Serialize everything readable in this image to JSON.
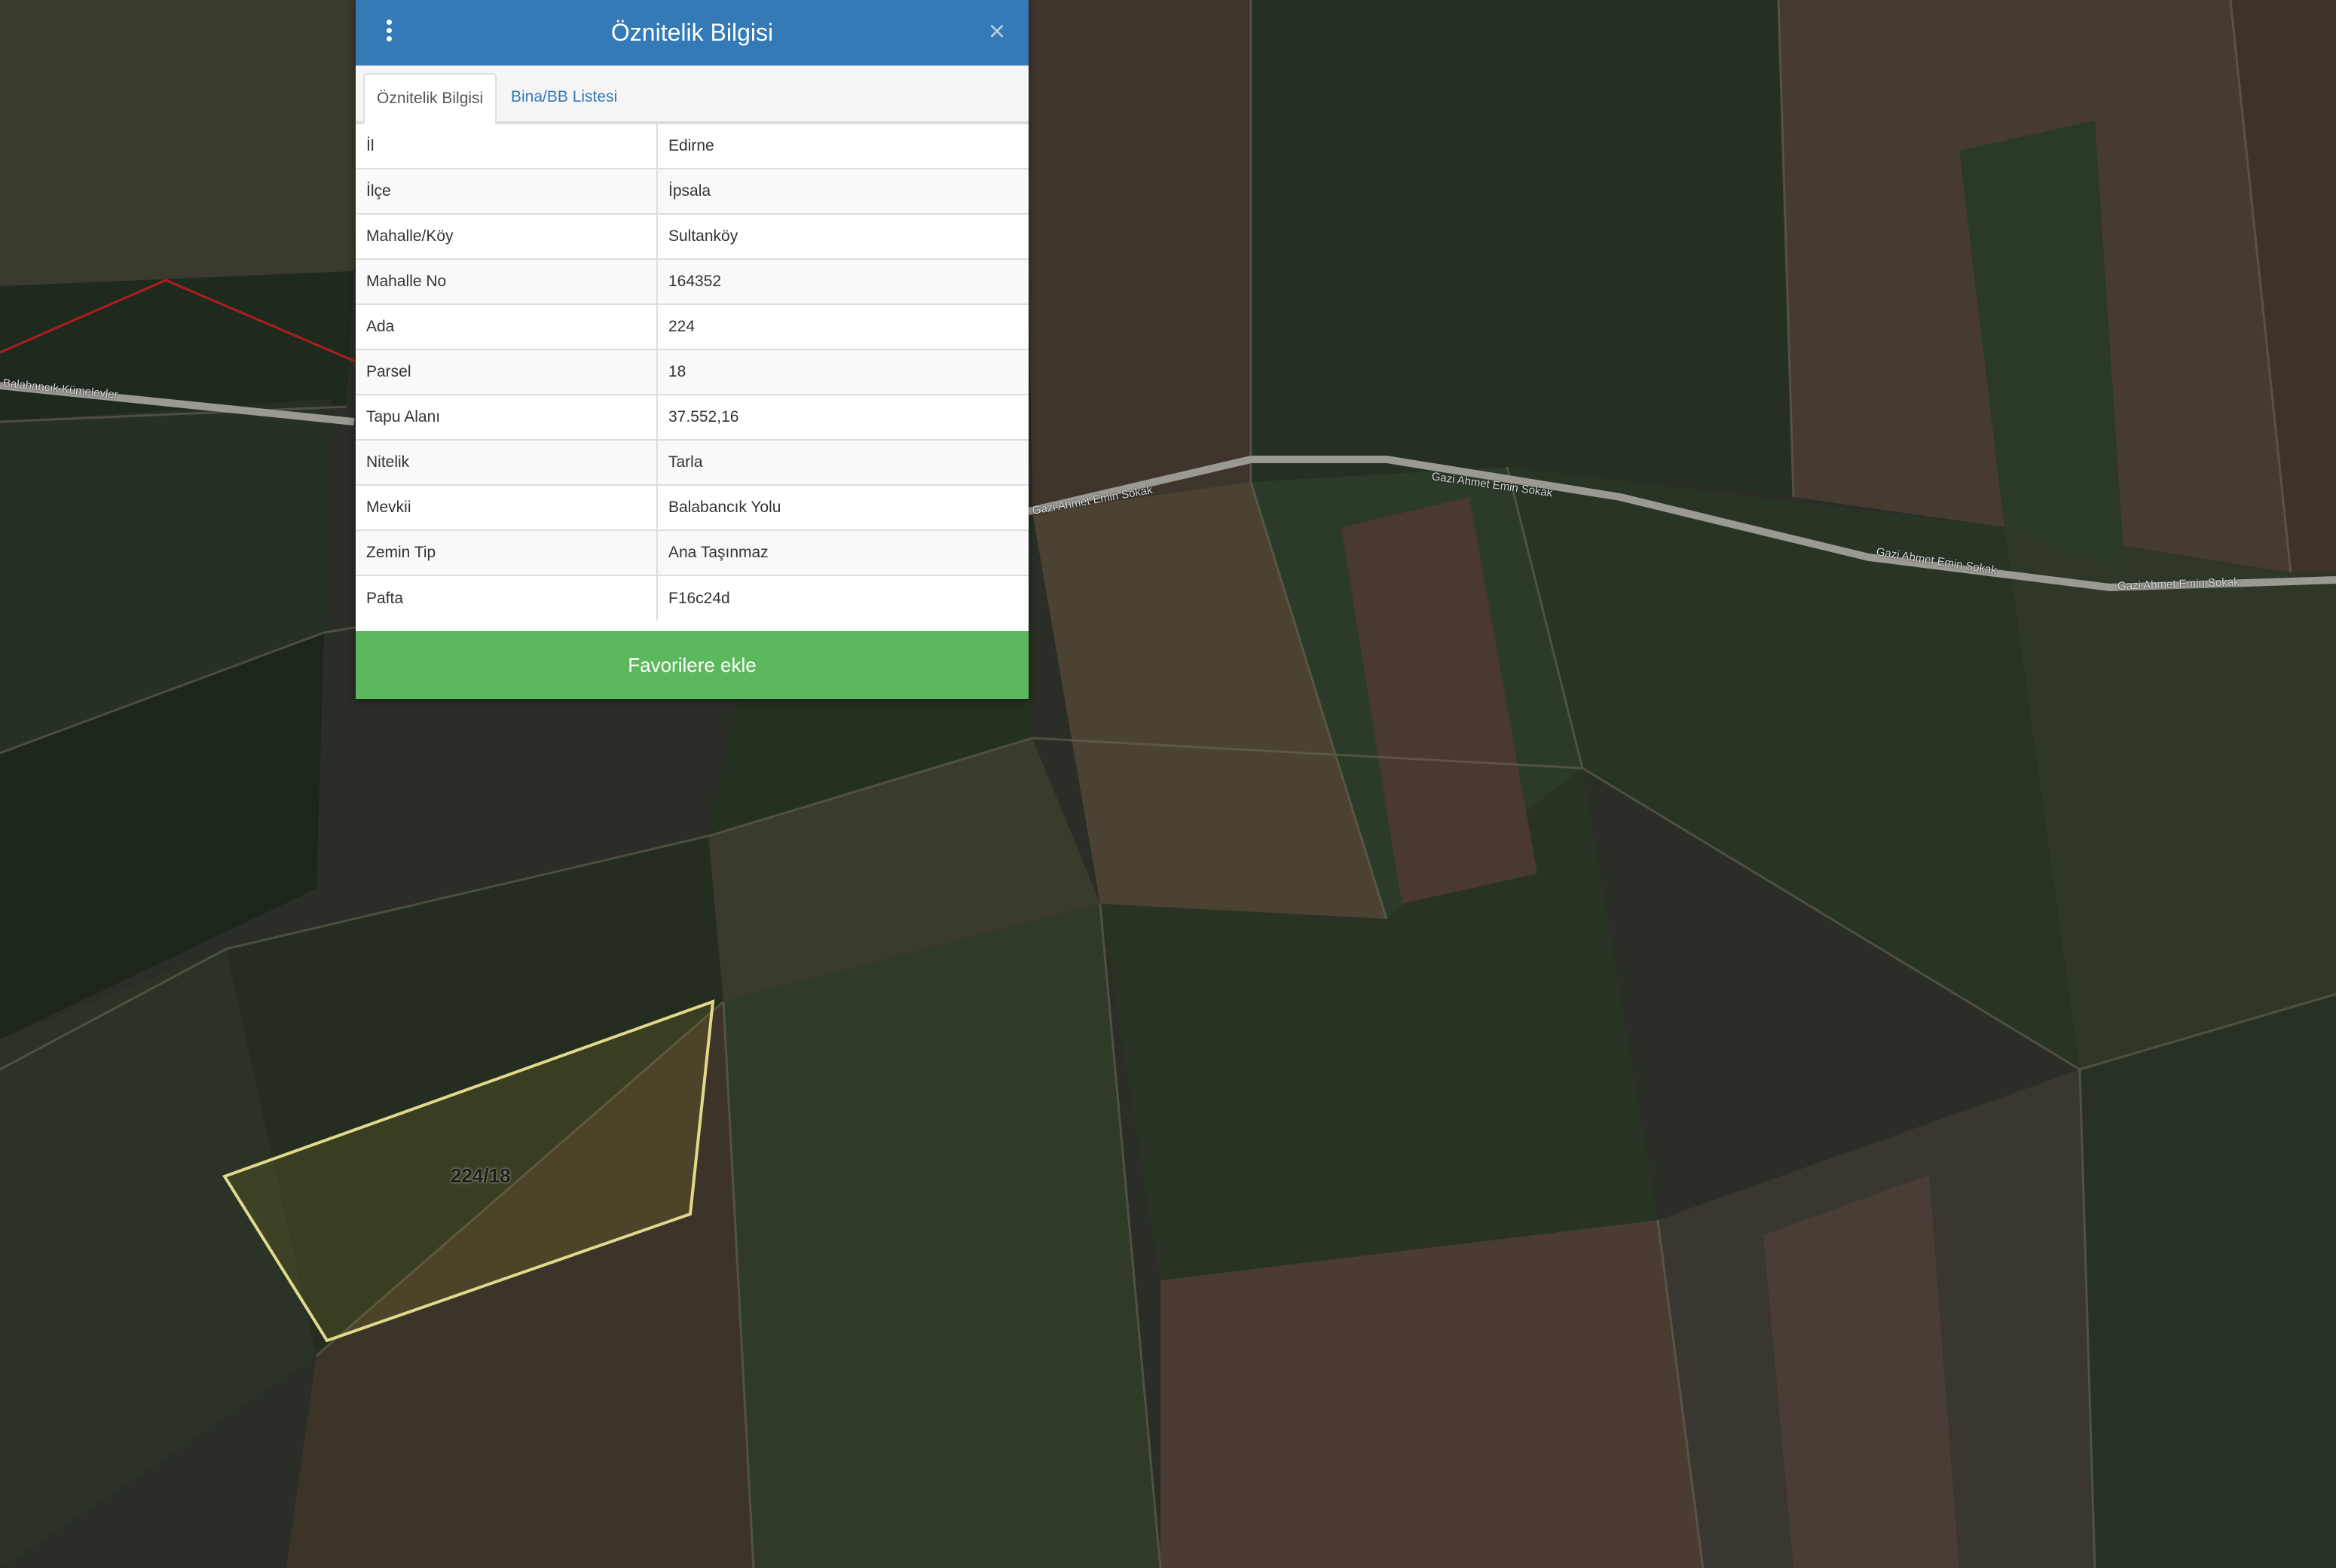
{
  "panel": {
    "title": "Öznitelik Bilgisi",
    "close_label": "×",
    "tabs": [
      {
        "label": "Öznitelik Bilgisi",
        "active": true
      },
      {
        "label": "Bina/BB Listesi",
        "active": false
      }
    ],
    "rows": [
      {
        "key": "İl",
        "value": "Edirne"
      },
      {
        "key": "İlçe",
        "value": "İpsala"
      },
      {
        "key": "Mahalle/Köy",
        "value": "Sultanköy"
      },
      {
        "key": "Mahalle No",
        "value": "164352"
      },
      {
        "key": "Ada",
        "value": "224"
      },
      {
        "key": "Parsel",
        "value": "18"
      },
      {
        "key": "Tapu Alanı",
        "value": "37.552,16"
      },
      {
        "key": "Nitelik",
        "value": "Tarla"
      },
      {
        "key": "Mevkii",
        "value": "Balabancık Yolu"
      },
      {
        "key": "Zemin Tip",
        "value": "Ana Taşınmaz"
      },
      {
        "key": "Pafta",
        "value": "F16c24d"
      }
    ],
    "favorite_button": "Favorilere ekle"
  },
  "map": {
    "parcel_label": "224/18",
    "road_labels": {
      "road_a": "Balabancık Kümelevler",
      "road_b1": "Gazi Ahmet Emin Sokak",
      "road_b2": "Gazi Ahmet Emin Sokak",
      "road_b3": "Gazi Ahmet Emin Sokak",
      "road_b4": "Gazi Ahmet Emin Sokak"
    },
    "colors": {
      "parcel_outline": "#e0d98a",
      "boundary_line": "#b01e1e",
      "road": "#9a9a92",
      "header": "#337ab7",
      "favorite": "#5cb85c"
    }
  }
}
